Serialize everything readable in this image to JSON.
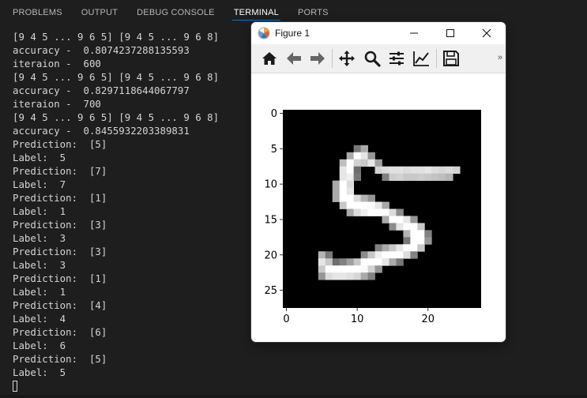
{
  "tabs": [
    {
      "label": "PROBLEMS",
      "active": false
    },
    {
      "label": "OUTPUT",
      "active": false
    },
    {
      "label": "DEBUG CONSOLE",
      "active": false
    },
    {
      "label": "TERMINAL",
      "active": true
    },
    {
      "label": "PORTS",
      "active": false
    }
  ],
  "terminal": {
    "lines": [
      "[9 4 5 ... 9 6 5] [9 4 5 ... 9 6 8]",
      "accuracy -  0.8074237288135593",
      "iteraion -  600",
      "[9 4 5 ... 9 6 5] [9 4 5 ... 9 6 8]",
      "accuracy -  0.8297118644067797",
      "iteraion -  700",
      "[9 4 5 ... 9 6 5] [9 4 5 ... 9 6 8]",
      "accuracy -  0.8455932203389831",
      "Prediction:  [5]",
      "Label:  5",
      "Prediction:  [7]",
      "Label:  7",
      "Prediction:  [1]",
      "Label:  1",
      "Prediction:  [3]",
      "Label:  3",
      "Prediction:  [3]",
      "Label:  3",
      "Prediction:  [1]",
      "Label:  1",
      "Prediction:  [4]",
      "Label:  4",
      "Prediction:  [6]",
      "Label:  6",
      "Prediction:  [5]",
      "Label:  5"
    ]
  },
  "figure": {
    "title": "Figure 1",
    "toolbar_icons": [
      "home-icon",
      "back-arrow-icon",
      "forward-arrow-icon",
      "pan-icon",
      "zoom-icon",
      "configure-subplots-icon",
      "edit-axis-icon",
      "save-icon"
    ],
    "more_glyph": "»",
    "yticks": [
      "0",
      "5",
      "10",
      "15",
      "20",
      "25"
    ],
    "xticks": [
      "0",
      "10",
      "20"
    ]
  },
  "chart_data": {
    "type": "heatmap",
    "colormap": "gray",
    "title": "",
    "xlabel": "",
    "ylabel": "",
    "rows": 28,
    "cols": 28,
    "xlim": [
      0,
      27
    ],
    "ylim": [
      27,
      0
    ],
    "xticks": [
      0,
      10,
      20
    ],
    "yticks": [
      0,
      5,
      10,
      15,
      20,
      25
    ],
    "nonzero_pixels": [
      [
        5,
        10,
        120
      ],
      [
        5,
        11,
        170
      ],
      [
        6,
        9,
        170
      ],
      [
        6,
        10,
        255
      ],
      [
        6,
        11,
        230
      ],
      [
        6,
        12,
        150
      ],
      [
        7,
        8,
        190
      ],
      [
        7,
        9,
        255
      ],
      [
        7,
        10,
        210
      ],
      [
        7,
        11,
        200
      ],
      [
        7,
        12,
        230
      ],
      [
        7,
        13,
        160
      ],
      [
        8,
        8,
        230
      ],
      [
        8,
        9,
        255
      ],
      [
        8,
        10,
        110
      ],
      [
        8,
        13,
        210
      ],
      [
        8,
        14,
        220
      ],
      [
        8,
        15,
        225
      ],
      [
        8,
        16,
        225
      ],
      [
        8,
        17,
        220
      ],
      [
        8,
        18,
        225
      ],
      [
        8,
        19,
        225
      ],
      [
        8,
        20,
        230
      ],
      [
        8,
        21,
        220
      ],
      [
        8,
        22,
        215
      ],
      [
        8,
        23,
        220
      ],
      [
        8,
        24,
        210
      ],
      [
        9,
        8,
        230
      ],
      [
        9,
        9,
        240
      ],
      [
        9,
        10,
        120
      ],
      [
        9,
        14,
        130
      ],
      [
        9,
        15,
        205
      ],
      [
        9,
        16,
        210
      ],
      [
        9,
        17,
        200
      ],
      [
        9,
        18,
        200
      ],
      [
        9,
        19,
        205
      ],
      [
        9,
        20,
        200
      ],
      [
        9,
        21,
        195
      ],
      [
        9,
        22,
        190
      ],
      [
        9,
        23,
        180
      ],
      [
        10,
        7,
        170
      ],
      [
        10,
        8,
        255
      ],
      [
        10,
        9,
        220
      ],
      [
        11,
        7,
        170
      ],
      [
        11,
        8,
        255
      ],
      [
        11,
        9,
        230
      ],
      [
        12,
        7,
        170
      ],
      [
        12,
        8,
        255
      ],
      [
        12,
        9,
        255
      ],
      [
        12,
        10,
        220
      ],
      [
        12,
        11,
        180
      ],
      [
        12,
        12,
        150
      ],
      [
        13,
        8,
        200
      ],
      [
        13,
        9,
        255
      ],
      [
        13,
        10,
        255
      ],
      [
        13,
        11,
        255
      ],
      [
        13,
        12,
        250
      ],
      [
        13,
        13,
        230
      ],
      [
        13,
        14,
        170
      ],
      [
        14,
        9,
        170
      ],
      [
        14,
        10,
        220
      ],
      [
        14,
        11,
        240
      ],
      [
        14,
        12,
        255
      ],
      [
        14,
        13,
        255
      ],
      [
        14,
        14,
        255
      ],
      [
        14,
        15,
        220
      ],
      [
        14,
        16,
        140
      ],
      [
        15,
        14,
        170
      ],
      [
        15,
        15,
        255
      ],
      [
        15,
        16,
        255
      ],
      [
        15,
        17,
        230
      ],
      [
        15,
        18,
        150
      ],
      [
        16,
        15,
        140
      ],
      [
        16,
        16,
        230
      ],
      [
        16,
        17,
        255
      ],
      [
        16,
        18,
        255
      ],
      [
        16,
        19,
        200
      ],
      [
        17,
        17,
        180
      ],
      [
        17,
        18,
        255
      ],
      [
        17,
        19,
        255
      ],
      [
        17,
        20,
        130
      ],
      [
        18,
        17,
        120
      ],
      [
        18,
        18,
        255
      ],
      [
        18,
        19,
        255
      ],
      [
        18,
        20,
        150
      ],
      [
        19,
        13,
        130
      ],
      [
        19,
        14,
        170
      ],
      [
        19,
        15,
        200
      ],
      [
        19,
        16,
        230
      ],
      [
        19,
        17,
        255
      ],
      [
        19,
        18,
        255
      ],
      [
        19,
        19,
        200
      ],
      [
        20,
        5,
        180
      ],
      [
        20,
        6,
        120
      ],
      [
        20,
        11,
        140
      ],
      [
        20,
        12,
        200
      ],
      [
        20,
        13,
        240
      ],
      [
        20,
        14,
        255
      ],
      [
        20,
        15,
        255
      ],
      [
        20,
        16,
        255
      ],
      [
        20,
        17,
        220
      ],
      [
        20,
        18,
        130
      ],
      [
        21,
        5,
        230
      ],
      [
        21,
        6,
        200
      ],
      [
        21,
        7,
        110
      ],
      [
        21,
        8,
        130
      ],
      [
        21,
        9,
        160
      ],
      [
        21,
        10,
        200
      ],
      [
        21,
        11,
        255
      ],
      [
        21,
        12,
        255
      ],
      [
        21,
        13,
        255
      ],
      [
        21,
        14,
        230
      ],
      [
        21,
        15,
        170
      ],
      [
        21,
        16,
        120
      ],
      [
        22,
        5,
        200
      ],
      [
        22,
        6,
        255
      ],
      [
        22,
        7,
        255
      ],
      [
        22,
        8,
        255
      ],
      [
        22,
        9,
        255
      ],
      [
        22,
        10,
        255
      ],
      [
        22,
        11,
        250
      ],
      [
        22,
        12,
        210
      ],
      [
        22,
        13,
        150
      ],
      [
        23,
        5,
        150
      ],
      [
        23,
        6,
        220
      ],
      [
        23,
        7,
        230
      ],
      [
        23,
        8,
        230
      ],
      [
        23,
        9,
        225
      ],
      [
        23,
        10,
        215
      ],
      [
        23,
        11,
        170
      ],
      [
        23,
        12,
        130
      ]
    ]
  }
}
